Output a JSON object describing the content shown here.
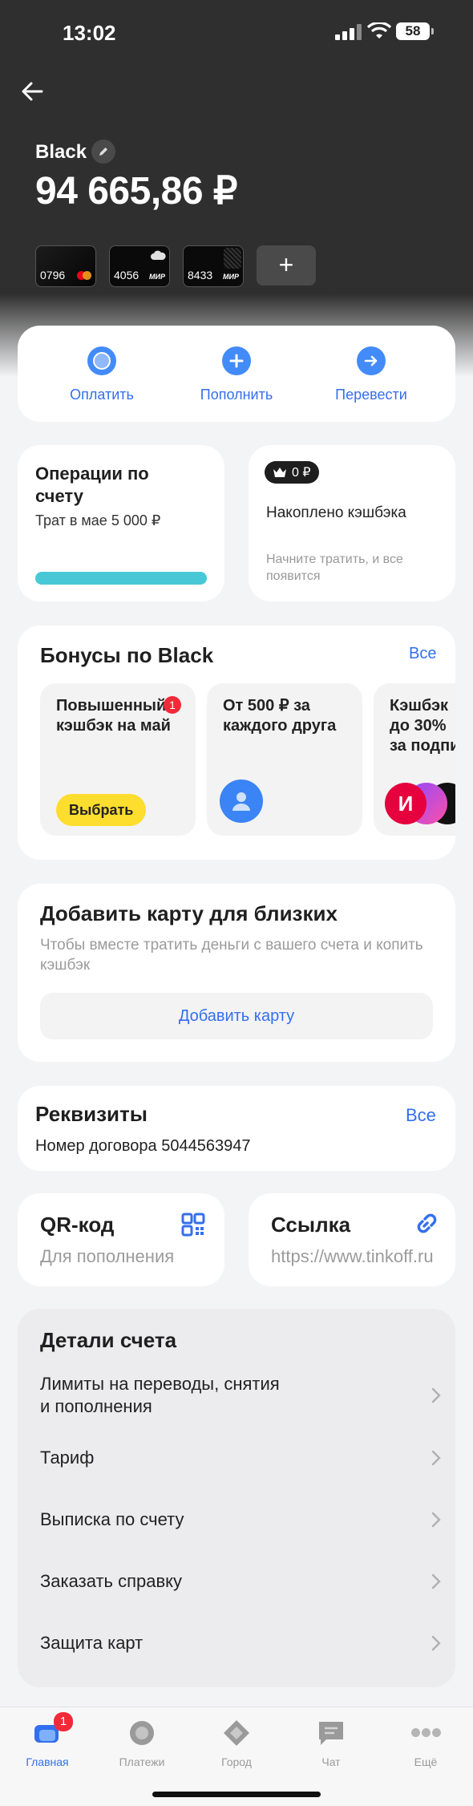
{
  "status_bar": {
    "time": "13:02",
    "battery": "58"
  },
  "account": {
    "name": "Black",
    "balance": "94 665,86 ₽"
  },
  "cards": [
    {
      "number": "0796",
      "network": "mastercard"
    },
    {
      "number": "4056",
      "network": "МИР"
    },
    {
      "number": "8433",
      "network": "МИР"
    }
  ],
  "add_card_symbol": "+",
  "actions": {
    "pay": "Оплатить",
    "topup": "Пополнить",
    "transfer": "Перевести"
  },
  "operations": {
    "title": "Операции по счету",
    "spent": "Трат в мае 5 000 ₽",
    "progress": 1.0,
    "bar_color": "#48c8d7"
  },
  "cashback": {
    "amount": "0 ₽",
    "title": "Накоплено кэшбэка",
    "hint": "Начните тратить, и все появится"
  },
  "bonuses": {
    "title": "Бонусы по Black",
    "all": "Все",
    "items": [
      {
        "title": "Повышенный кэшбэк на май",
        "badge": "1",
        "button": "Выбрать"
      },
      {
        "title": "От 500 ₽ за каждого друга"
      },
      {
        "title": "Кэшбэк до 30% за подпи"
      }
    ]
  },
  "family": {
    "title": "Добавить карту для близких",
    "desc": "Чтобы вместе тратить деньги с вашего счета и копить кэшбэк",
    "button": "Добавить карту"
  },
  "requisites": {
    "title": "Реквизиты",
    "all": "Все",
    "contract": "Номер договора 5044563947"
  },
  "qr": {
    "title": "QR-код",
    "sub": "Для пополнения"
  },
  "link": {
    "title": "Ссылка",
    "sub": "https://www.tinkoff.ru"
  },
  "details": {
    "title": "Детали счета",
    "items": [
      "Лимиты на переводы, снятия и пополнения",
      "Тариф",
      "Выписка по счету",
      "Заказать справку",
      "Защита карт"
    ]
  },
  "tabbar": {
    "items": [
      {
        "label": "Главная",
        "badge": "1"
      },
      {
        "label": "Платежи"
      },
      {
        "label": "Город"
      },
      {
        "label": "Чат"
      },
      {
        "label": "Ещё"
      }
    ]
  },
  "colors": {
    "accent": "#336fee",
    "dark": "#2f2f2f",
    "badge": "#f22a38",
    "yellow": "#fddd2d"
  }
}
